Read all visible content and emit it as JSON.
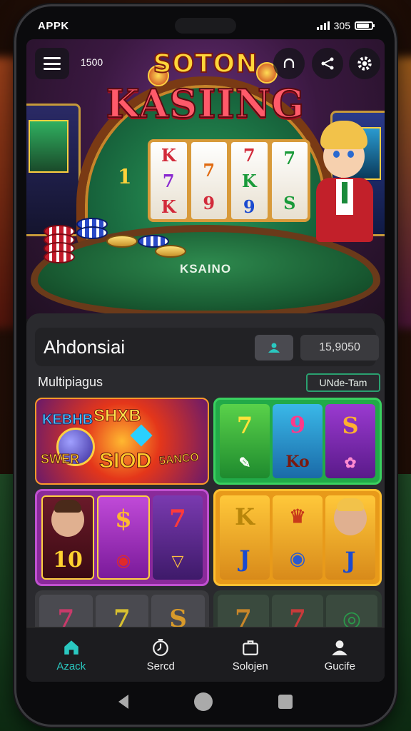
{
  "status_bar": {
    "carrier": "APPK",
    "time": "305"
  },
  "hero": {
    "logo_top": "SOTON",
    "logo_main": "KASIING",
    "table_label": "KSAINO",
    "balance": "1500",
    "side_symbol": "1",
    "reels": [
      [
        "K",
        "7",
        "K"
      ],
      [
        "",
        "7",
        "9"
      ],
      [
        "7",
        "K",
        "9"
      ],
      [
        "7",
        "",
        "S"
      ]
    ]
  },
  "top_icons": [
    "menu-icon",
    "headphones-icon",
    "share-icon",
    "settings-icon"
  ],
  "panel": {
    "title": "Ahdonsiai",
    "counter": "15,9050",
    "section_label": "Multipiagus",
    "section_link": "UNde-Tam"
  },
  "tiles": {
    "tile1": {
      "t1": "KEBHB",
      "t2": "SHXB",
      "t3": "SIOD",
      "t4": "SWER",
      "t5": "5ANCO"
    },
    "tile2": {
      "c1": [
        "7",
        ""
      ],
      "c2": [
        "9",
        "Ko"
      ],
      "c3": [
        "S",
        ""
      ]
    },
    "tile3": {
      "c1": "10",
      "c2": "$",
      "c3": "7"
    },
    "tile4": {
      "c1": [
        "K",
        "J"
      ],
      "c3": [
        "",
        "J"
      ]
    },
    "tile5": [
      "7",
      "7",
      "S"
    ],
    "tile6": [
      "7",
      "7",
      ""
    ]
  },
  "bottom_nav": [
    {
      "label": "Azack",
      "icon": "home-icon",
      "active": true
    },
    {
      "label": "Sercd",
      "icon": "timer-icon",
      "active": false
    },
    {
      "label": "Solojen",
      "icon": "briefcase-icon",
      "active": false
    },
    {
      "label": "Gucife",
      "icon": "profile-icon",
      "active": false
    }
  ],
  "colors": {
    "accent": "#2ac8c0",
    "link_border": "#2aa070",
    "panel_bg": "#2a2a2e"
  }
}
